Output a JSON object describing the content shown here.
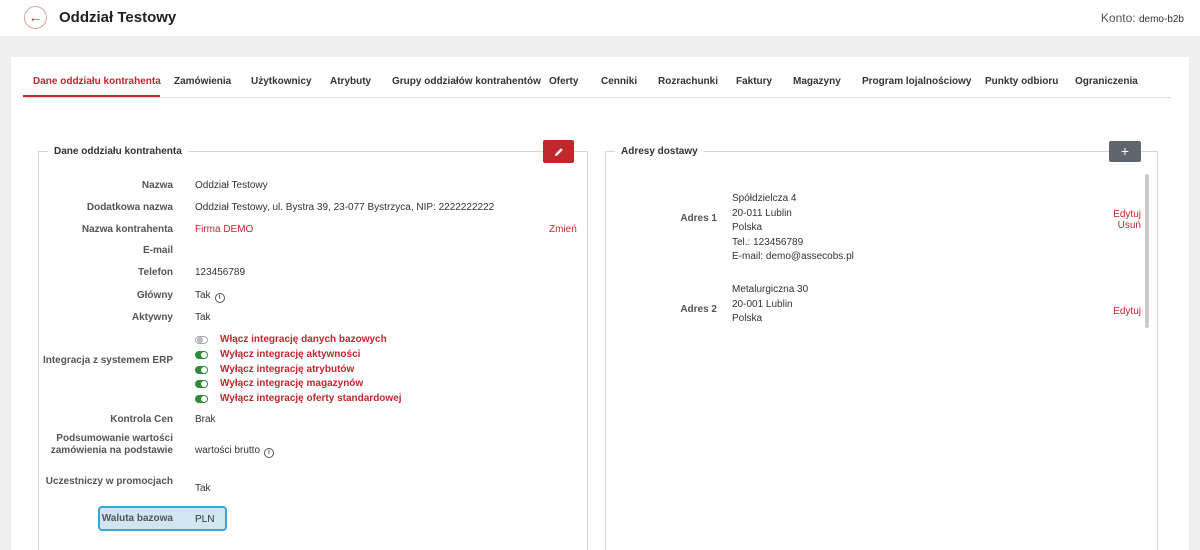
{
  "header": {
    "back_icon": "arrow-left-icon",
    "title": "Oddział Testowy",
    "account_label": "Konto:",
    "account_value": "demo-b2b"
  },
  "tabs": [
    {
      "label": "Dane oddziału kontrahenta",
      "active": true
    },
    {
      "label": "Zamówienia"
    },
    {
      "label": "Użytkownicy"
    },
    {
      "label": "Atrybuty"
    },
    {
      "label": "Grupy oddziałów kontrahentów"
    },
    {
      "label": "Oferty"
    },
    {
      "label": "Cenniki"
    },
    {
      "label": "Rozrachunki"
    },
    {
      "label": "Faktury"
    },
    {
      "label": "Magazyny"
    },
    {
      "label": "Program lojalnościowy"
    },
    {
      "label": "Punkty odbioru"
    },
    {
      "label": "Ograniczenia"
    }
  ],
  "details": {
    "title": "Dane oddziału kontrahenta",
    "edit_icon": "pencil-icon",
    "nazwa_label": "Nazwa",
    "nazwa_value": "Oddział Testowy",
    "dodatkowa_label": "Dodatkowa nazwa",
    "dodatkowa_value": "Oddział Testowy, ul. Bystra 39, 23-077 Bystrzyca, NIP: 2222222222",
    "kontrahent_label": "Nazwa kontrahenta",
    "kontrahent_value": "Firma DEMO",
    "zmien_label": "Zmień",
    "email_label": "E-mail",
    "email_value": "",
    "telefon_label": "Telefon",
    "telefon_value": "123456789",
    "glowny_label": "Główny",
    "glowny_value": "Tak",
    "aktywny_label": "Aktywny",
    "aktywny_value": "Tak",
    "erp_label": "Integracja z systemem ERP",
    "erp_toggles": [
      {
        "label": "Włącz integrację danych bazowych",
        "on": false
      },
      {
        "label": "Wyłącz integrację aktywności",
        "on": true
      },
      {
        "label": "Wyłącz integrację atrybutów",
        "on": true
      },
      {
        "label": "Wyłącz integrację magazynów",
        "on": true
      },
      {
        "label": "Wyłącz integrację oferty standardowej",
        "on": true
      }
    ],
    "kontrola_label": "Kontrola Cen",
    "kontrola_value": "Brak",
    "podsumowanie_label": "Podsumowanie wartości zamówienia na podstawie",
    "podsumowanie_value": "wartości brutto",
    "promocje_label": "Uczestniczy w promocjach",
    "promocje_value": "Tak",
    "waluta_label": "Waluta bazowa",
    "waluta_value": "PLN"
  },
  "addresses": {
    "title": "Adresy dostawy",
    "add_label": "+",
    "items": [
      {
        "label": "Adres 1",
        "street": "Spółdzielcza 4",
        "city": "20-011 Lublin",
        "country": "Polska",
        "phone": "Tel.: 123456789",
        "email": "E-mail: demo@assecobs.pl",
        "edit": "Edytuj",
        "delete": "Usuń"
      },
      {
        "label": "Adres 2",
        "street": "Metalurgiczna 30",
        "city": "20-001 Lublin",
        "country": "Polska",
        "edit": "Edytuj"
      }
    ]
  },
  "colors": {
    "accent": "#c0282e",
    "toggle_on": "#2e8b3a",
    "highlight": "#37a6d8"
  }
}
